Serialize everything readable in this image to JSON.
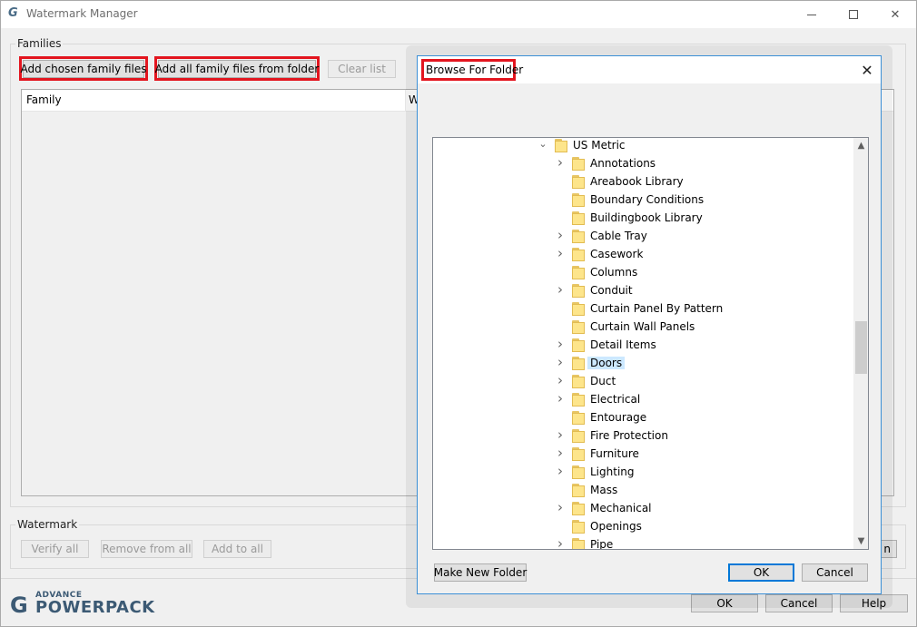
{
  "window": {
    "logo_glyph": "G",
    "title": "Watermark Manager",
    "controls": {
      "minimize": "minimize-icon",
      "maximize": "maximize-icon",
      "close": "close-icon"
    }
  },
  "families": {
    "group_label": "Families",
    "add_chosen_label": "Add chosen family files",
    "add_all_label": "Add all family files from folder",
    "clear_list_label": "Clear list",
    "columns": [
      "Family",
      "W"
    ]
  },
  "watermark": {
    "group_label": "Watermark",
    "verify_all_label": "Verify all",
    "remove_from_all_label": "Remove from all",
    "add_to_all_label": "Add to all",
    "hidden_button_fragment": "n"
  },
  "footer": {
    "brand_small": "ADVANCE",
    "brand_big": "POWERPACK",
    "brand_glyph": "G",
    "ok_label": "OK",
    "cancel_label": "Cancel",
    "help_label": "Help"
  },
  "browse_dialog": {
    "title": "Browse For Folder",
    "close_glyph": "✕",
    "root": {
      "label": "US Metric",
      "expanded": true
    },
    "items": [
      {
        "label": "Annotations",
        "expandable": true
      },
      {
        "label": "Areabook Library",
        "expandable": false
      },
      {
        "label": "Boundary Conditions",
        "expandable": false
      },
      {
        "label": "Buildingbook Library",
        "expandable": false
      },
      {
        "label": "Cable Tray",
        "expandable": true
      },
      {
        "label": "Casework",
        "expandable": true
      },
      {
        "label": "Columns",
        "expandable": false
      },
      {
        "label": "Conduit",
        "expandable": true
      },
      {
        "label": "Curtain Panel By Pattern",
        "expandable": false
      },
      {
        "label": "Curtain Wall Panels",
        "expandable": false
      },
      {
        "label": "Detail Items",
        "expandable": true
      },
      {
        "label": "Doors",
        "expandable": true,
        "selected": true
      },
      {
        "label": "Duct",
        "expandable": true
      },
      {
        "label": "Electrical",
        "expandable": true
      },
      {
        "label": "Entourage",
        "expandable": false
      },
      {
        "label": "Fire Protection",
        "expandable": true
      },
      {
        "label": "Furniture",
        "expandable": true
      },
      {
        "label": "Lighting",
        "expandable": true
      },
      {
        "label": "Mass",
        "expandable": false
      },
      {
        "label": "Mechanical",
        "expandable": true
      },
      {
        "label": "Openings",
        "expandable": false
      },
      {
        "label": "Pipe",
        "expandable": true
      }
    ],
    "make_new_folder_label": "Make New Folder",
    "ok_label": "OK",
    "cancel_label": "Cancel"
  },
  "colors": {
    "highlight": "#e3151f",
    "selection": "#cce8ff",
    "accent": "#0078d7",
    "folder": "#fde58b"
  }
}
